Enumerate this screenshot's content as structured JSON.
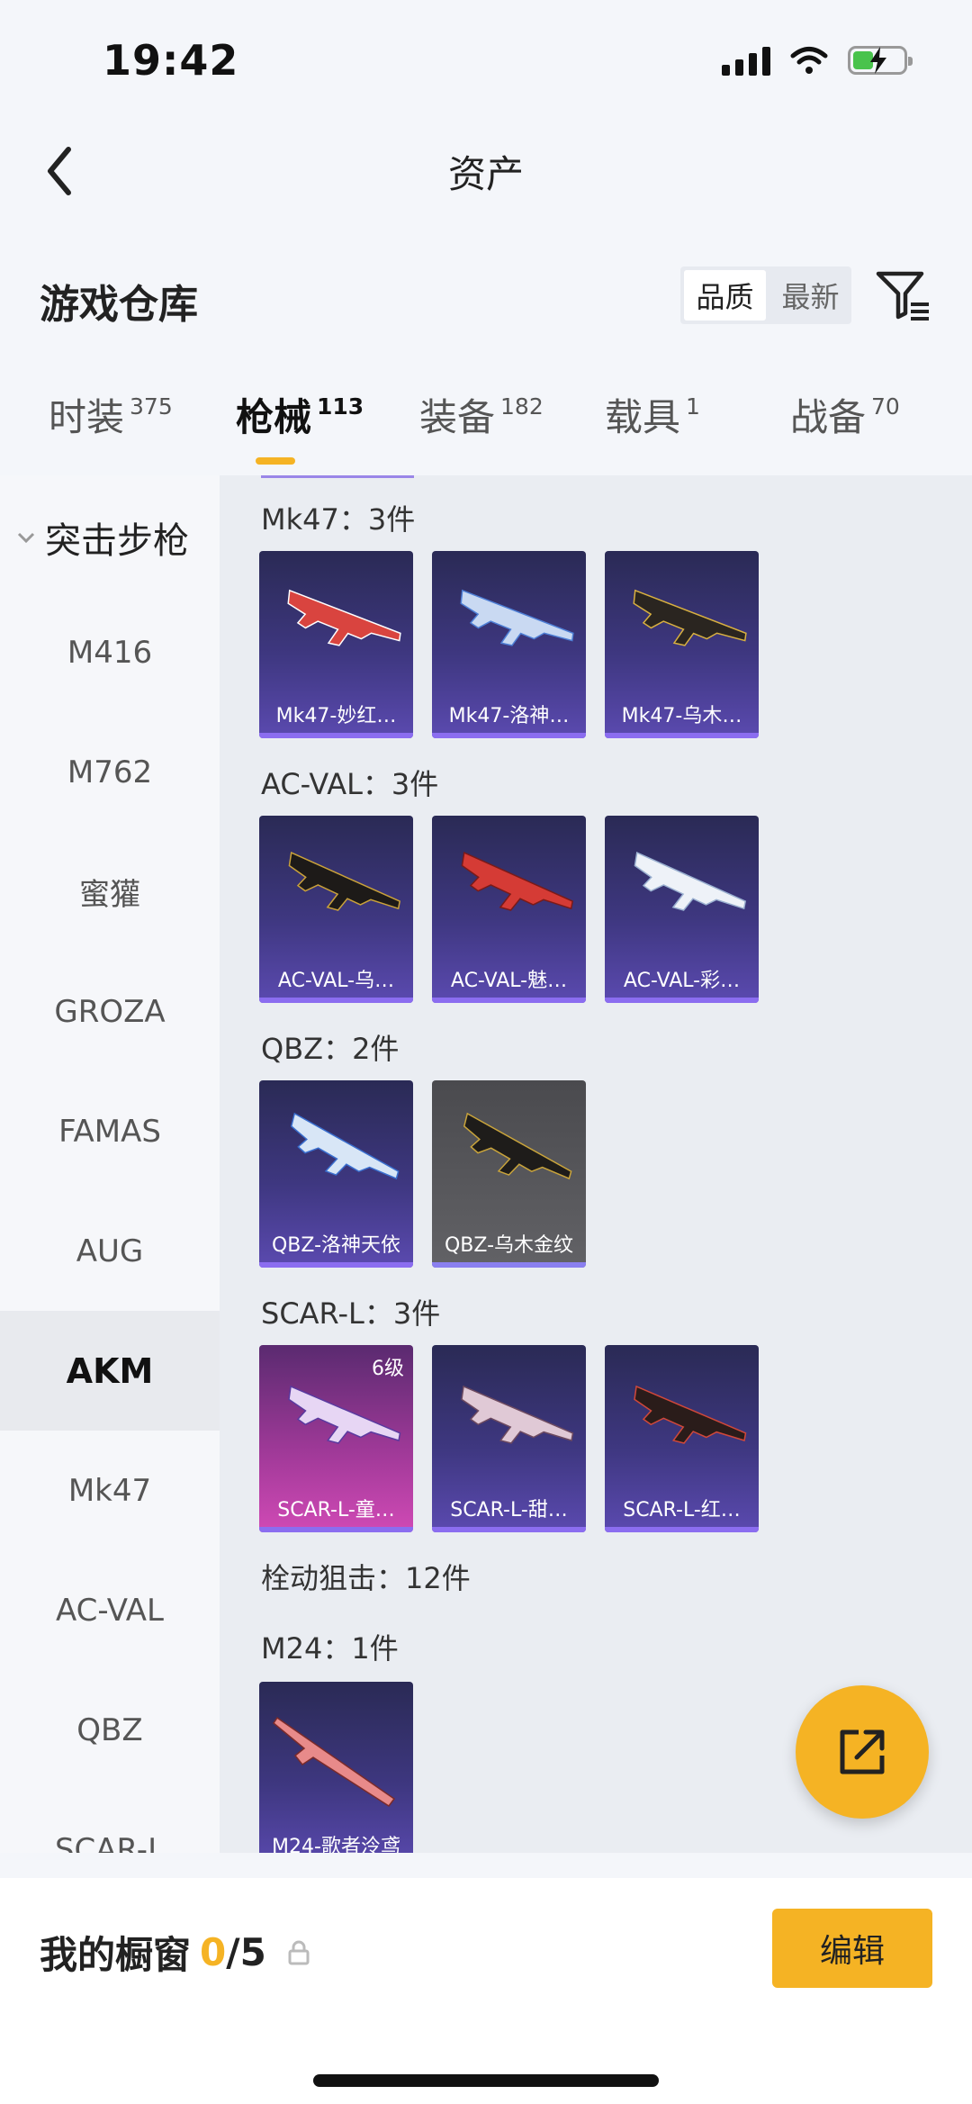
{
  "status": {
    "time": "19:42"
  },
  "header": {
    "title": "资产"
  },
  "warehouse": {
    "title": "游戏仓库",
    "sort_quality": "品质",
    "sort_latest": "最新"
  },
  "tabs": [
    {
      "label": "时装",
      "count": "375"
    },
    {
      "label": "枪械",
      "count": "113"
    },
    {
      "label": "装备",
      "count": "182"
    },
    {
      "label": "载具",
      "count": "1"
    },
    {
      "label": "战备",
      "count": "70"
    }
  ],
  "sidebar": {
    "category": "突击步枪",
    "items": [
      "M416",
      "M762",
      "蜜獾",
      "GROZA",
      "FAMAS",
      "AUG",
      "AKM",
      "Mk47",
      "AC-VAL",
      "QBZ",
      "SCAR-L"
    ],
    "active_index": 6
  },
  "groups": [
    {
      "title": "Mk47：3件",
      "items": [
        "Mk47-妙红…",
        "Mk47-洛神…",
        "Mk47-乌木…"
      ]
    },
    {
      "title": "AC-VAL：3件",
      "items": [
        "AC-VAL-乌…",
        "AC-VAL-魅…",
        "AC-VAL-彩…"
      ]
    },
    {
      "title": "QBZ：2件",
      "items": [
        "QBZ-洛神天依",
        "QBZ-乌木金纹"
      ]
    },
    {
      "title": "SCAR-L：3件",
      "items": [
        "SCAR-L-童…",
        "SCAR-L-甜…",
        "SCAR-L-红…"
      ],
      "level_badge": "6级"
    },
    {
      "title": "栓动狙击：12件"
    },
    {
      "title": "M24：1件",
      "items": [
        "M24-歌者泠鸢"
      ]
    }
  ],
  "bottom": {
    "showcase_label": "我的橱窗",
    "showcase_count": "0",
    "showcase_total": "/5",
    "edit_label": "编辑"
  },
  "colors": {
    "accent": "#f5b324",
    "card_purple": "#3e3780",
    "card_bar": "#8b6df0"
  }
}
